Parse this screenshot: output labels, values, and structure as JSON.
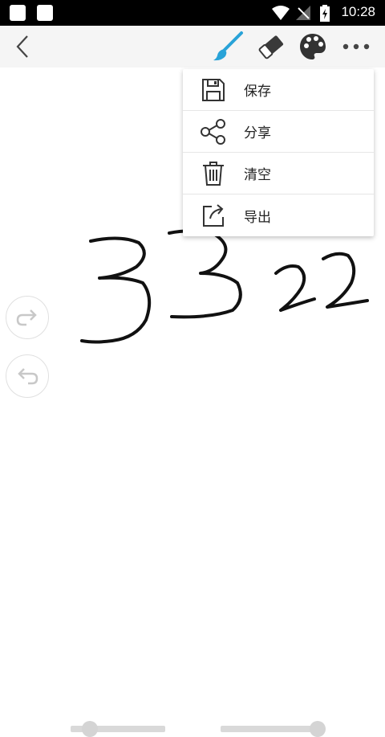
{
  "status_bar": {
    "time": "10:28"
  },
  "toolbar": {
    "icons": [
      "back-arrow-icon",
      "brush-icon",
      "eraser-icon",
      "palette-icon",
      "more-icon"
    ],
    "brush_color": "#29a3d8"
  },
  "menu": {
    "items": [
      {
        "label": "保存",
        "icon": "save-icon"
      },
      {
        "label": "分享",
        "icon": "share-icon"
      },
      {
        "label": "清空",
        "icon": "trash-icon"
      },
      {
        "label": "导出",
        "icon": "export-icon"
      }
    ]
  },
  "canvas": {
    "handwriting": "3322"
  },
  "sliders": {
    "stroke_width_level": 0.2,
    "opacity_level": 0.95
  }
}
